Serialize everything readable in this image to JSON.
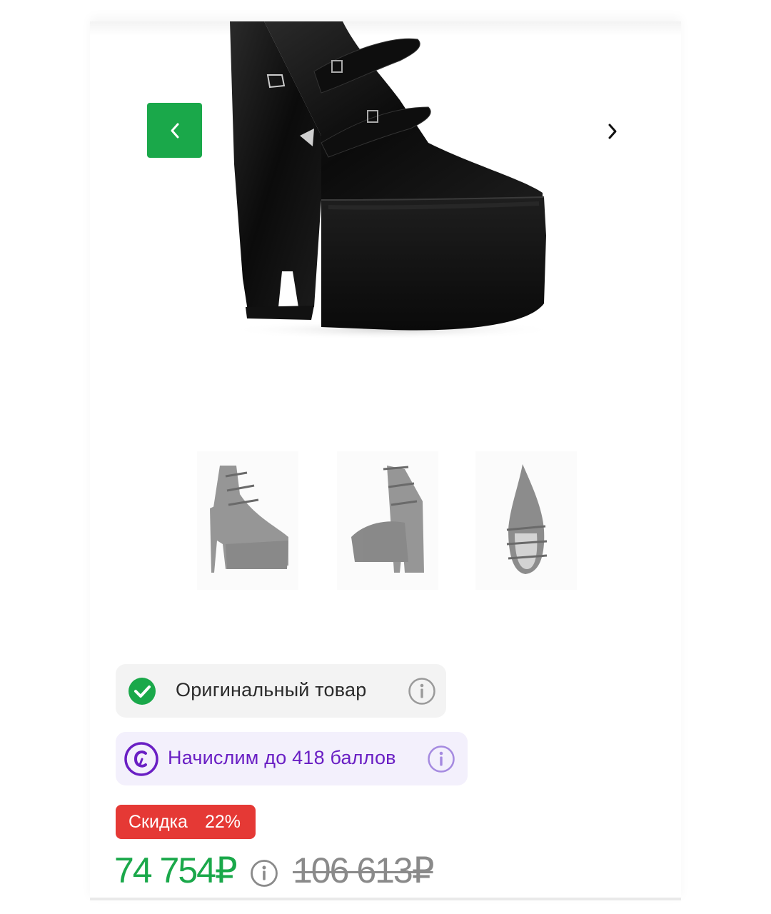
{
  "gallery": {
    "hero_image": "black satin platform wedge pump with ankle straps",
    "prev_icon": "chevron-left-icon",
    "next_icon": "chevron-right-icon",
    "accent_color": "#1aa84a",
    "thumbnails": [
      {
        "name": "thumbnail-side-view"
      },
      {
        "name": "thumbnail-back-view"
      },
      {
        "name": "thumbnail-top-view"
      }
    ]
  },
  "badges": {
    "original_label": "Оригинальный товар",
    "original_icon": "check-circle-icon",
    "bonus_label": "Начислим до 418 баллов",
    "bonus_icon": "bonus-coin-icon",
    "bonus_color": "#6a1fc4",
    "info_icon": "info-icon"
  },
  "discount": {
    "label": "Скидка",
    "percent": "22%",
    "color": "#e53935"
  },
  "price": {
    "current": "74 754₽",
    "old": "106 613₽",
    "current_color": "#1aa84a"
  }
}
